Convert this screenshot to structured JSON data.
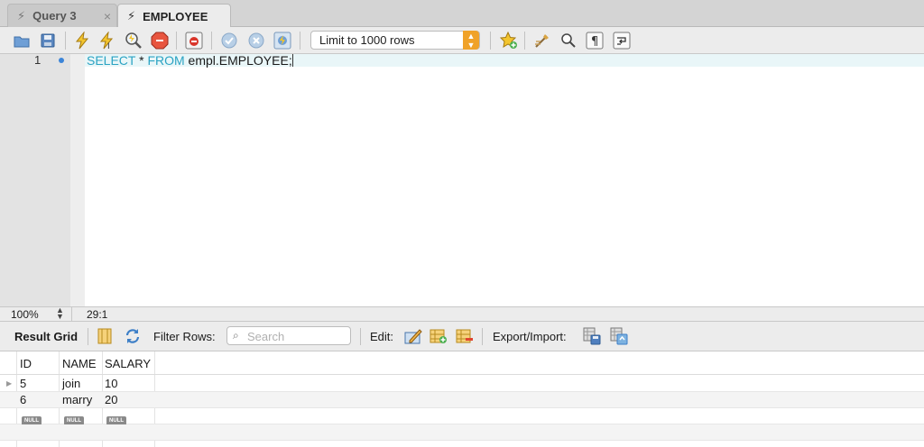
{
  "tabs": [
    {
      "label": "Query 3",
      "active": false,
      "close": "×"
    },
    {
      "label": "EMPLOYEE",
      "active": true
    }
  ],
  "toolbar": {
    "limit_select": "Limit to 1000 rows",
    "icons": [
      "open-folder-icon",
      "save-icon",
      "execute-icon",
      "execute-current-icon",
      "explain-icon",
      "stop-icon",
      "toggle-error-icon",
      "commit-icon",
      "rollback-icon",
      "autocommit-icon",
      "add-snippet-icon",
      "beautify-icon",
      "find-icon",
      "invisible-chars-icon",
      "wrap-icon"
    ]
  },
  "editor": {
    "line_number": "1",
    "code": {
      "kw1": "SELECT",
      "star": " * ",
      "kw2": "FROM",
      "target": " empl.EMPLOYEE;"
    }
  },
  "status": {
    "zoom": "100%",
    "cursor": "29:1"
  },
  "result_toolbar": {
    "result_grid_label": "Result Grid",
    "filter_label": "Filter Rows:",
    "filter_placeholder": "Search",
    "edit_label": "Edit:",
    "export_label": "Export/Import:"
  },
  "grid": {
    "columns": [
      "ID",
      "NAME",
      "SALARY"
    ],
    "rows": [
      [
        "5",
        "join",
        "10"
      ],
      [
        "6",
        "marry",
        "20"
      ]
    ],
    "null_label": "NULL"
  },
  "colors": {
    "keyword": "#2aa3c3",
    "accent": "#f0a229",
    "line_marker": "#3c85d8"
  }
}
